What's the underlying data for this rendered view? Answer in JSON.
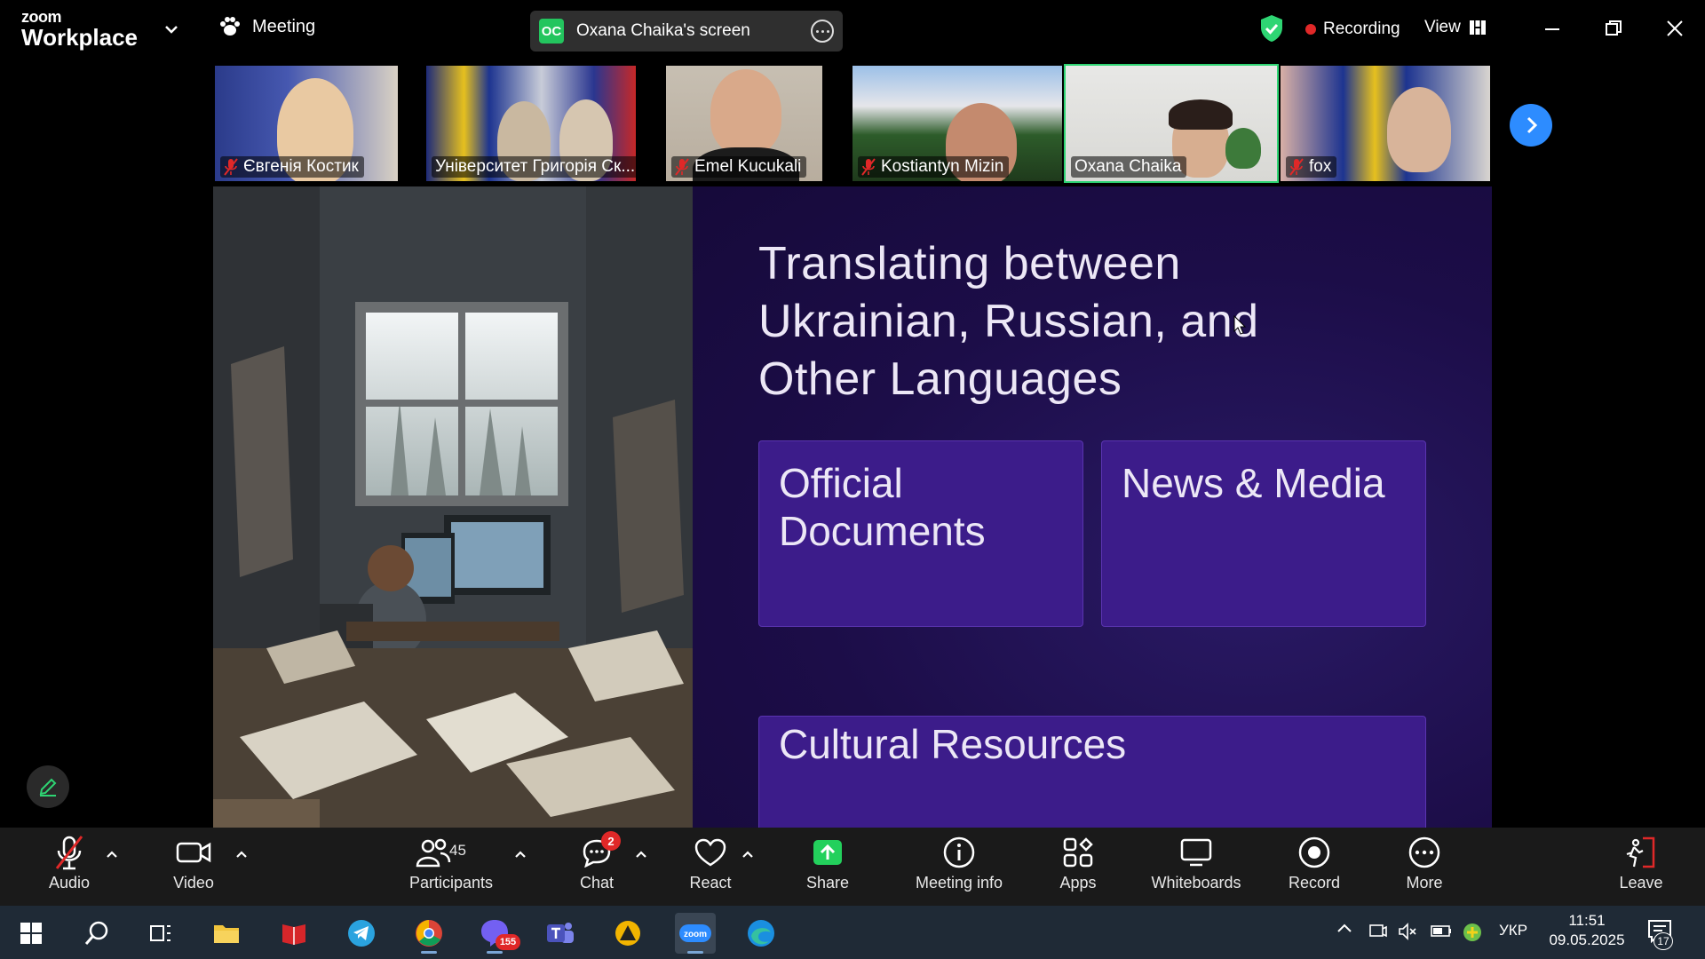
{
  "app": {
    "brand_top": "zoom",
    "brand_bottom": "Workplace"
  },
  "header": {
    "meeting_label": "Meeting",
    "screen_badge": "OC",
    "screen_label": "Oxana Chaika's screen",
    "recording_label": "Recording",
    "view_label": "View"
  },
  "participants_strip": [
    {
      "name": "Євгенія Костик",
      "muted": true
    },
    {
      "name": "Університет Григорія Ск...",
      "muted": false
    },
    {
      "name": "Emel Kucukali",
      "muted": true
    },
    {
      "name": "Kostiantyn Mizin",
      "muted": true
    },
    {
      "name": "Oxana Chaika",
      "muted": false,
      "active": true
    },
    {
      "name": "fox",
      "muted": true
    }
  ],
  "slide": {
    "title": "Translating between Ukrainian, Russian, and Other Languages",
    "cards": [
      "Official Documents",
      "News & Media",
      "Cultural Resources"
    ]
  },
  "toolbar": {
    "audio": "Audio",
    "video": "Video",
    "participants": "Participants",
    "participants_count": "45",
    "chat": "Chat",
    "chat_badge": "2",
    "react": "React",
    "share": "Share",
    "meeting_info": "Meeting info",
    "apps": "Apps",
    "whiteboards": "Whiteboards",
    "record": "Record",
    "more": "More",
    "leave": "Leave"
  },
  "taskbar": {
    "viber_badge": "155",
    "language": "УКР",
    "time": "11:51",
    "date": "09.05.2025",
    "notifications": "17"
  },
  "colors": {
    "accent": "#2d8cff",
    "active_border": "#2ed573",
    "recording": "#e02828",
    "share_green": "#23d05c",
    "slide_bg": "#1c0d48",
    "card_bg": "#3c1c8a"
  }
}
